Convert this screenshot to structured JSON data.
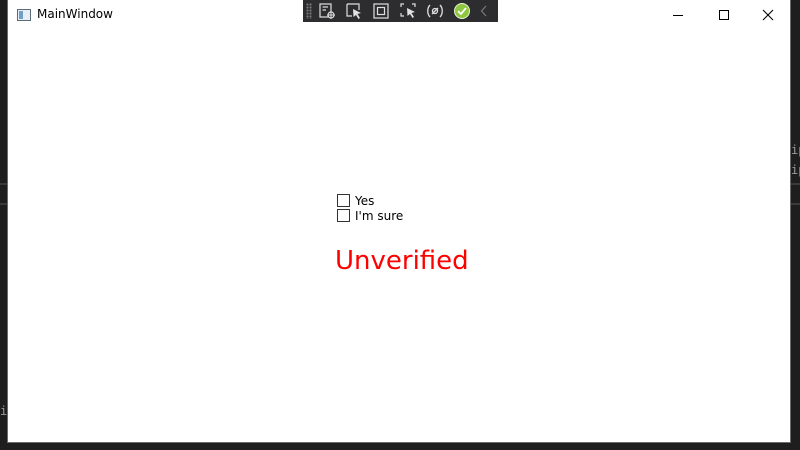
{
  "window": {
    "title": "MainWindow"
  },
  "background_fragments": {
    "right_top": "ip",
    "right_bottom": "ip",
    "left_bottom": "i"
  },
  "debug_toolbar": {
    "buttons": [
      {
        "icon": "live-visual-tree-icon"
      },
      {
        "icon": "select-element-icon"
      },
      {
        "icon": "display-layout-adorners-icon"
      },
      {
        "icon": "track-focused-element-icon"
      },
      {
        "icon": "binding-failures-icon"
      },
      {
        "icon": "verified-check-icon"
      }
    ]
  },
  "checkboxes": [
    {
      "label": "Yes",
      "checked": false
    },
    {
      "label": "I'm sure",
      "checked": false
    }
  ],
  "status": {
    "text": "Unverified",
    "color": "#ff0000"
  }
}
